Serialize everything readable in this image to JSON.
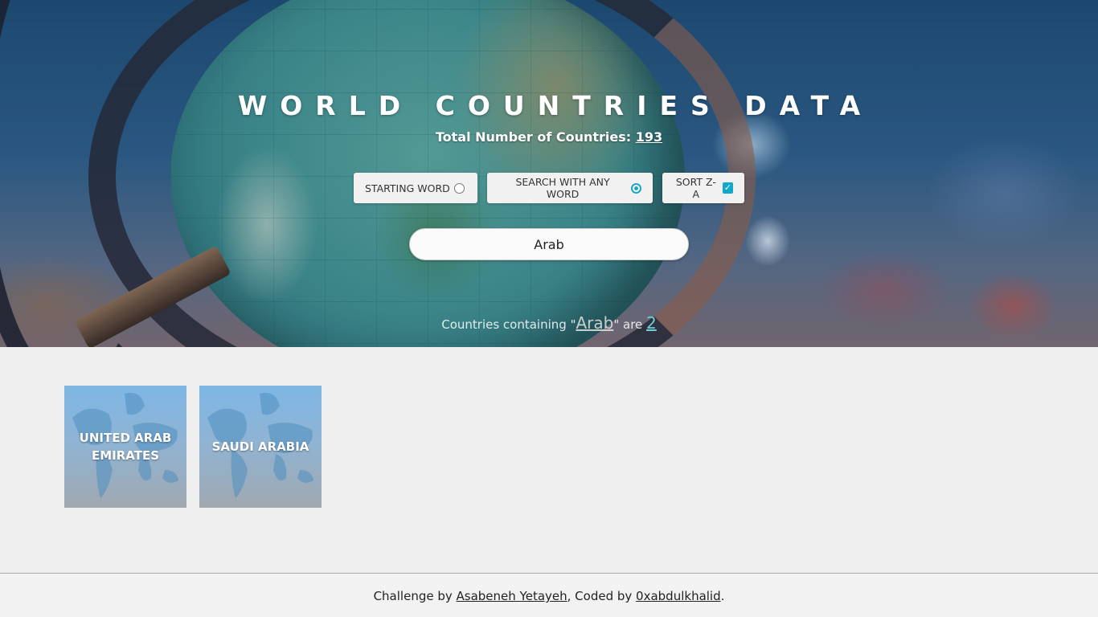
{
  "header": {
    "title": "WORLD COUNTRIES DATA",
    "total_label": "Total Number of Countries: ",
    "total_count": "193"
  },
  "options": [
    {
      "label": "STARTING WORD",
      "control": "radio",
      "checked": false
    },
    {
      "label": "SEARCH WITH ANY WORD",
      "control": "radio",
      "checked": true
    },
    {
      "label": "SORT Z-A",
      "control": "checkbox",
      "checked": true
    }
  ],
  "search": {
    "value": "Arab"
  },
  "result": {
    "prefix": "Countries containing \"",
    "query": "Arab",
    "middle": "\" are ",
    "count": "2"
  },
  "countries": [
    {
      "name": "UNITED ARAB EMIRATES"
    },
    {
      "name": "SAUDI ARABIA"
    }
  ],
  "footer": {
    "prefix": "Challenge by ",
    "author": "Asabeneh Yetayeh",
    "middle": ", Coded by ",
    "coder": "0xabdulkhalid",
    "suffix": "."
  },
  "colors": {
    "accent": "#10a9c9",
    "page_background": "#efefef"
  }
}
